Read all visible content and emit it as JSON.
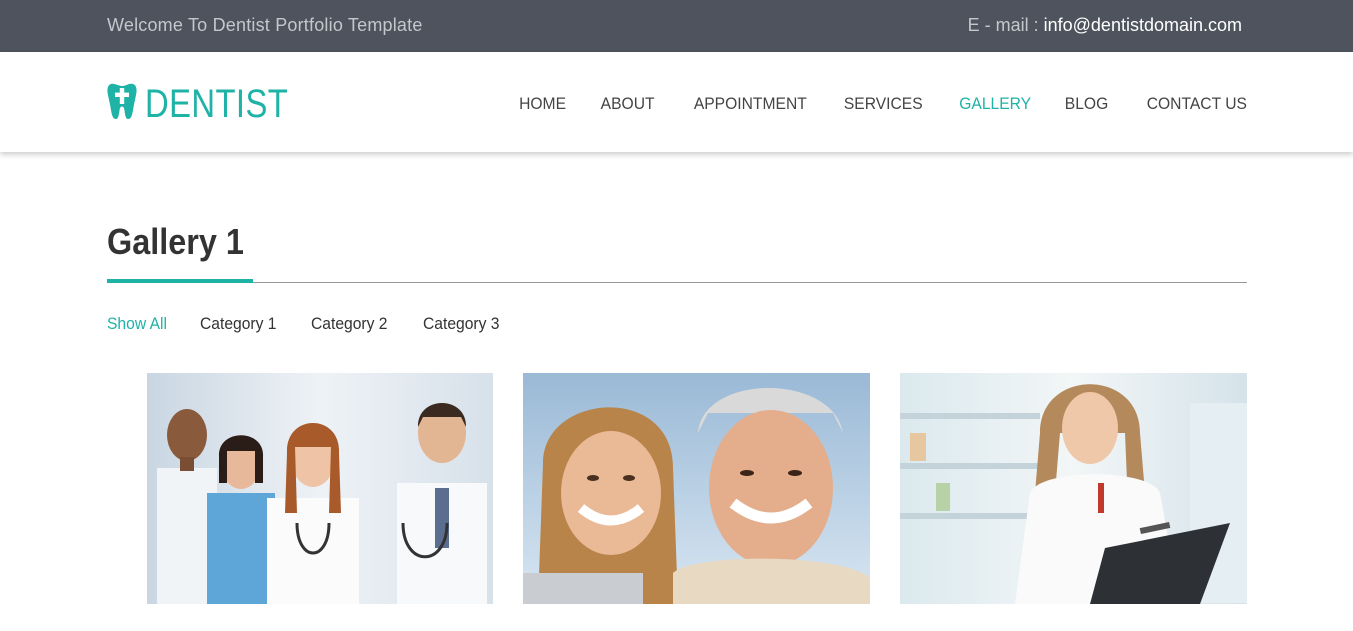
{
  "topbar": {
    "welcome": "Welcome To Dentist Portfolio Template",
    "email_label": "E - mail :",
    "email": "info@dentistdomain.com"
  },
  "brand": {
    "name": "DENTIST",
    "accent_color": "#1fb2a6"
  },
  "nav": {
    "items": [
      "HOME",
      "ABOUT",
      "APPOINTMENT",
      "SERVICES",
      "GALLERY",
      "BLOG",
      "CONTACT US"
    ],
    "active": "GALLERY"
  },
  "page": {
    "title": "Gallery 1"
  },
  "filters": {
    "items": [
      "Show All",
      "Category 1",
      "Category 2",
      "Category 3"
    ],
    "active": "Show All"
  },
  "gallery": [
    {
      "icon": "doctors-team-photo"
    },
    {
      "icon": "smiling-couple-photo"
    },
    {
      "icon": "pharmacist-clipboard-photo"
    }
  ]
}
